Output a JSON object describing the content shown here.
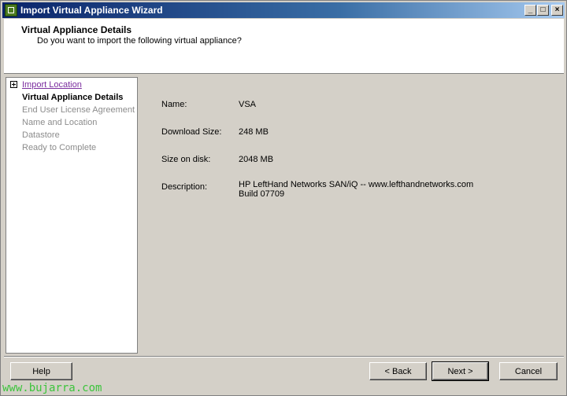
{
  "window": {
    "title": "Import Virtual Appliance Wizard",
    "controls": {
      "minimize": "_",
      "maximize": "□",
      "close": "×"
    }
  },
  "header": {
    "title": "Virtual Appliance Details",
    "subtitle": "Do you want to import the following virtual appliance?"
  },
  "steps": [
    {
      "label": "Import Location",
      "state": "visited-link"
    },
    {
      "label": "Virtual Appliance Details",
      "state": "current"
    },
    {
      "label": "End User License Agreement",
      "state": "future"
    },
    {
      "label": "Name and Location",
      "state": "future"
    },
    {
      "label": "Datastore",
      "state": "future"
    },
    {
      "label": "Ready to Complete",
      "state": "future"
    }
  ],
  "details": {
    "name_label": "Name:",
    "name_value": "VSA",
    "download_label": "Download Size:",
    "download_value": "248 MB",
    "disk_label": "Size on disk:",
    "disk_value": "2048 MB",
    "description_label": "Description:",
    "description_line1": "HP LeftHand Networks SAN/iQ -- www.lefthandnetworks.com",
    "description_line2": "Build 07709"
  },
  "buttons": {
    "help": "Help",
    "back": "< Back",
    "next": "Next >",
    "cancel": "Cancel"
  },
  "watermark": "www.bujarra.com",
  "colors": {
    "title_gradient_start": "#0a246a",
    "title_gradient_end": "#a6caf0",
    "visited_link": "#7a2c9e",
    "disabled_text": "#8c8c8c",
    "watermark": "#3cc43c"
  }
}
